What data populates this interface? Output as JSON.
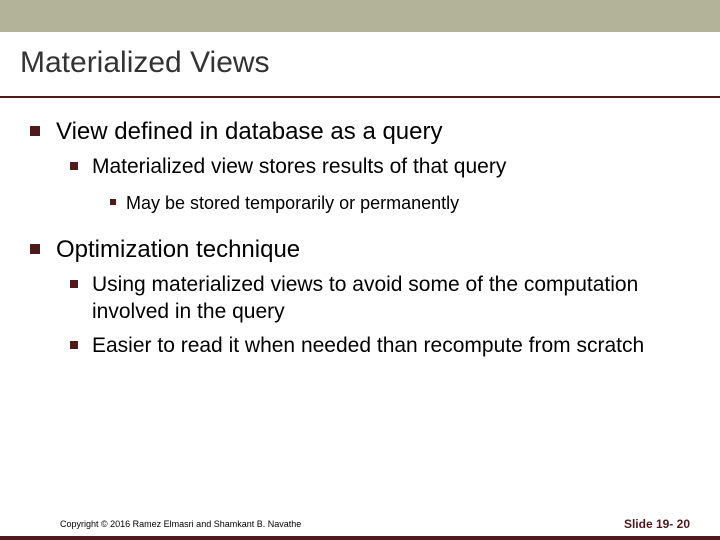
{
  "title": "Materialized Views",
  "bullets": {
    "b1": "View defined in database as a query",
    "b1_1": "Materialized view stores results of that query",
    "b1_1_1": "May be stored temporarily or permanently",
    "b2": "Optimization technique",
    "b2_1": "Using materialized views to avoid some of the computation involved in the query",
    "b2_2": "Easier to read it when needed than recompute from scratch"
  },
  "footer": {
    "copyright": "Copyright © 2016 Ramez Elmasri and Shamkant B. Navathe",
    "slide": "Slide 19- 20"
  }
}
